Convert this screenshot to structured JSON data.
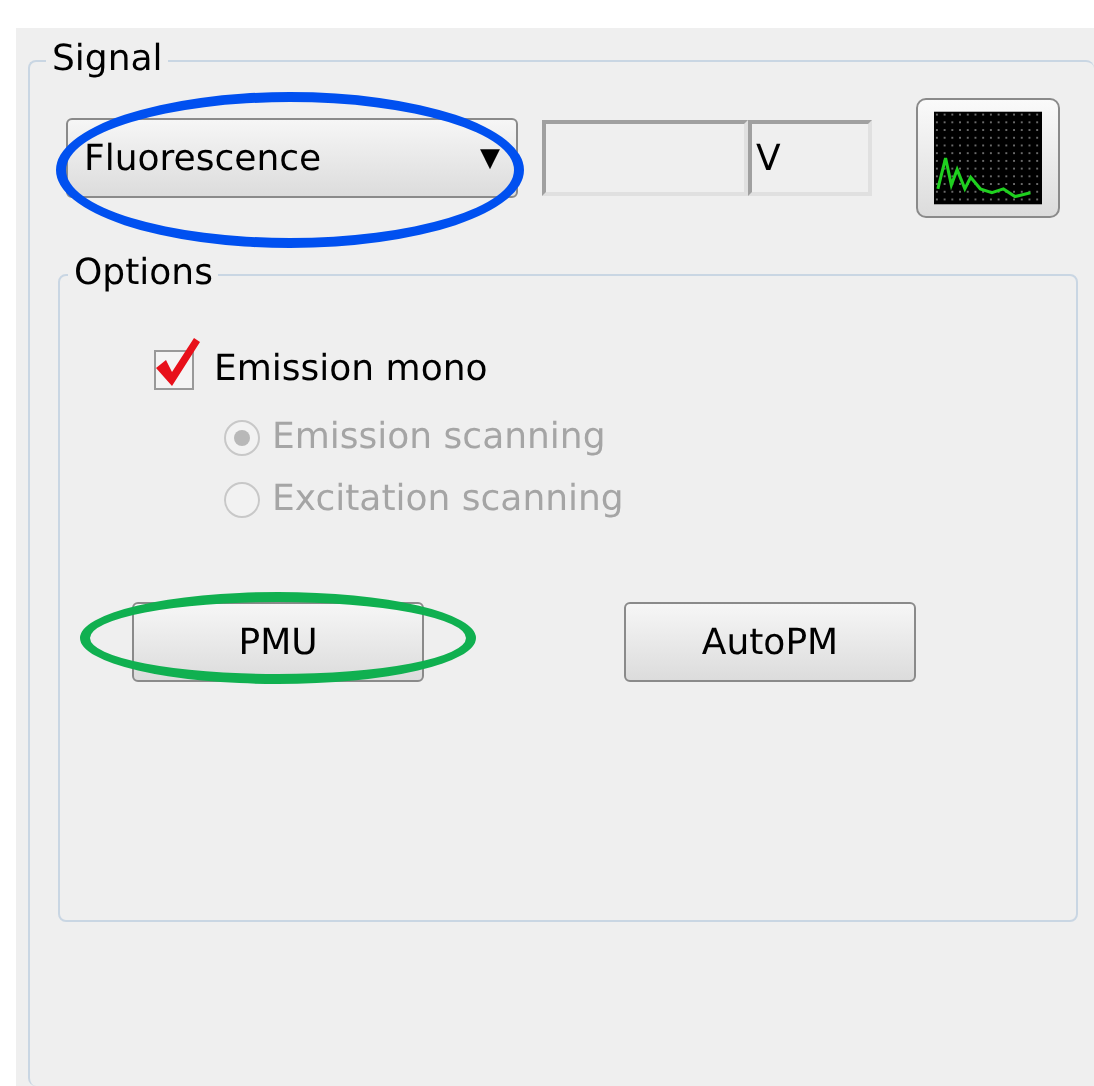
{
  "signal": {
    "title": "Signal",
    "mode_dropdown": {
      "value": "Fluorescence",
      "arrow": "▼"
    },
    "unit_field": {
      "value": "V"
    }
  },
  "options": {
    "title": "Options",
    "emission_mono": {
      "label": "Emission mono",
      "checked": true,
      "disabled": false
    },
    "scan_modes": [
      {
        "label": "Emission scanning",
        "selected": true,
        "disabled": true
      },
      {
        "label": "Excitation scanning",
        "selected": false,
        "disabled": true
      }
    ],
    "buttons": [
      {
        "label": "PMU"
      },
      {
        "label": "AutoPM"
      }
    ]
  },
  "highlights": [
    {
      "kind": "ellipse",
      "color": "#0050f0"
    },
    {
      "kind": "ellipse",
      "color": "#10b050"
    }
  ]
}
